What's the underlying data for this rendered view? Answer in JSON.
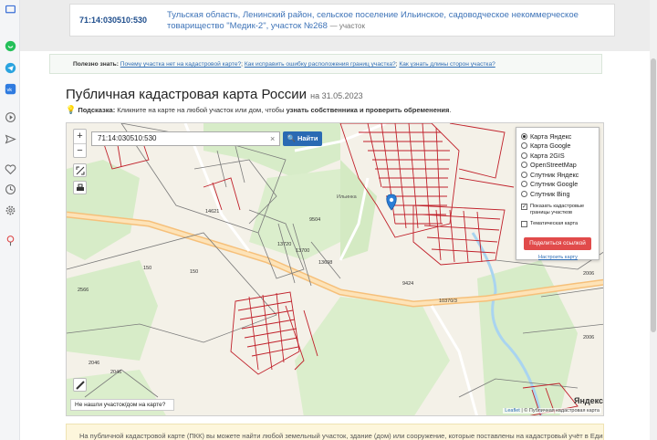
{
  "result": {
    "cadastral_number": "71:14:030510:530",
    "address": "Тульская область, Ленинский район, сельское поселение Ильинское, садоводческое некоммерческое товарищество \"Медик-2\", участок №268",
    "type_suffix": "— участок"
  },
  "useful": {
    "label": "Полезно знать:",
    "links": [
      "Почему участка нет на кадастровой карте?",
      "Как исправить ошибку расположения границ участка?",
      "Как узнать длины сторон участка?"
    ]
  },
  "page_title": "Публичная кадастровая карта России",
  "title_date": "на 31.05.2023",
  "hint": {
    "label": "Подсказка:",
    "text": "Кликните на карте на любой участок или дом, чтобы",
    "bold_text": "узнать собственника и проверить обременения",
    "end": "."
  },
  "map": {
    "search_value": "71:14:030510:530",
    "search_button": "Найти",
    "zoom_in": "+",
    "zoom_out": "−",
    "not_found_label": "Не нашли участок/дом на карте?",
    "yandex_logo": "Яндекс",
    "attribution_leaflet": "Leaflet",
    "attribution_rest": "| © Публичная кадастровая карта",
    "labels": [
      "8855",
      "14621",
      "9504",
      "13720",
      "13700",
      "13698",
      "9424",
      "2566",
      "150",
      "150",
      "2046",
      "2046",
      "2006",
      "2006",
      "10370/3",
      "Ильинка"
    ],
    "layers": [
      {
        "label": "Карта Яндекс",
        "selected": true
      },
      {
        "label": "Карта Google",
        "selected": false
      },
      {
        "label": "Карта 2GIS",
        "selected": false
      },
      {
        "label": "OpenStreetMap",
        "selected": false
      },
      {
        "label": "Спутник Яндекс",
        "selected": false
      },
      {
        "label": "Спутник Google",
        "selected": false
      },
      {
        "label": "Спутник Bing",
        "selected": false
      }
    ],
    "options": [
      {
        "label": "Показать кадастровые границы участков",
        "checked": true
      },
      {
        "label": "Тематическая карта",
        "checked": false
      }
    ],
    "share_button": "Поделиться ссылкой",
    "setup_link": "Настроить карту"
  },
  "info_text": "На публичной кадастровой карте (ПКК) вы можете найти любой земельный участок, здание (дом) или сооружение, которые поставлены на кадастровый учёт в Едином",
  "icons": [
    "message-icon",
    "whatsapp-icon",
    "telegram-icon",
    "vk-icon",
    "play-icon",
    "send-icon",
    "heart-icon",
    "clock-icon",
    "settings-icon",
    "pin-icon"
  ],
  "colors": {
    "accent": "#2a6ab3",
    "share": "#e14b4b",
    "parcel": "#c0202a"
  }
}
